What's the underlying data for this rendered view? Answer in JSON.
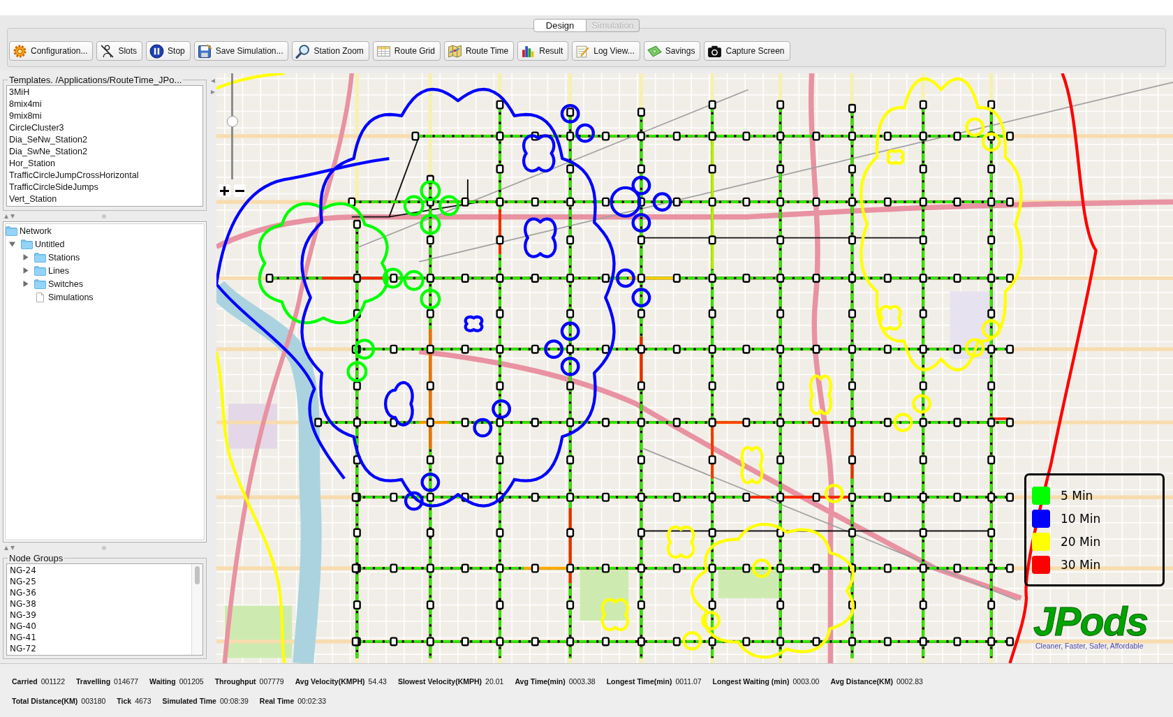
{
  "tabs": [
    {
      "label": "Design",
      "selected": true,
      "disabled": false
    },
    {
      "label": "Simulation",
      "selected": false,
      "disabled": true
    }
  ],
  "toolbar": {
    "buttons": [
      "Configuration...",
      "Slots",
      "Stop",
      "Save Simulation...",
      "Station Zoom",
      "Route Grid",
      "Route Time",
      "Result",
      "Log View...",
      "Savings",
      "Capture Screen"
    ]
  },
  "templates": {
    "title": "Templates. /Applications/RouteTime_JPo...",
    "items": [
      "3MiH",
      "8mix4mi",
      "9mix8mi",
      "CircleCluster3",
      "Dia_SeNw_Station2",
      "Dia_SwNe_Station2",
      "Hor_Station",
      "TrafficCircleJumpCrossHorizontal",
      "TrafficCircleSideJumps",
      "Vert_Station"
    ]
  },
  "network_tree": [
    {
      "label": "Network",
      "kind": "folder",
      "children": [
        {
          "label": "Untitled",
          "kind": "folder",
          "expanded": true,
          "children": [
            {
              "label": "Stations",
              "kind": "folder",
              "expanded": false
            },
            {
              "label": "Lines",
              "kind": "folder",
              "expanded": false
            },
            {
              "label": "Switches",
              "kind": "folder",
              "expanded": false
            },
            {
              "label": "Simulations",
              "kind": "file"
            }
          ]
        }
      ]
    }
  ],
  "node_groups": {
    "title": "Node Groups",
    "items": [
      "NG-24",
      "NG-25",
      "NG-36",
      "NG-38",
      "NG-39",
      "NG-40",
      "NG-41",
      "NG-72"
    ]
  },
  "map": {
    "zoom_slider": {
      "level": 0.55
    },
    "legend": [
      {
        "label": "5 Min",
        "color": "#00ff00"
      },
      {
        "label": "10 Min",
        "color": "#0000ff"
      },
      {
        "label": "20 Min",
        "color": "#ffff00"
      },
      {
        "label": "30 Min",
        "color": "#ff0000"
      }
    ],
    "logo": {
      "title": "JPods",
      "tagline": "Cleaner, Faster, Safer, Affordable"
    }
  },
  "status_bar": {
    "rows": [
      [
        {
          "label": "Carried",
          "value": "001122"
        },
        {
          "label": "Travelling",
          "value": "014677"
        },
        {
          "label": "Waiting",
          "value": "001205"
        },
        {
          "label": "Throughput",
          "value": "007779"
        },
        {
          "label": "Avg Velocity(KMPH)",
          "value": "54.43"
        },
        {
          "label": "Slowest Velocity(KMPH)",
          "value": "20.01"
        },
        {
          "label": "Avg Time(min)",
          "value": "0003.38"
        },
        {
          "label": "Longest Time(min)",
          "value": "0011.07"
        },
        {
          "label": "Longest Waiting (min)",
          "value": "0003.00"
        },
        {
          "label": "Avg Distance(KM)",
          "value": "0002.83"
        }
      ],
      [
        {
          "label": "Total Distance(KM)",
          "value": "003180"
        },
        {
          "label": "Tick",
          "value": "4673"
        },
        {
          "label": "Simulated Time",
          "value": "00:08:39"
        },
        {
          "label": "Real Time",
          "value": "00:02:33"
        }
      ]
    ]
  }
}
